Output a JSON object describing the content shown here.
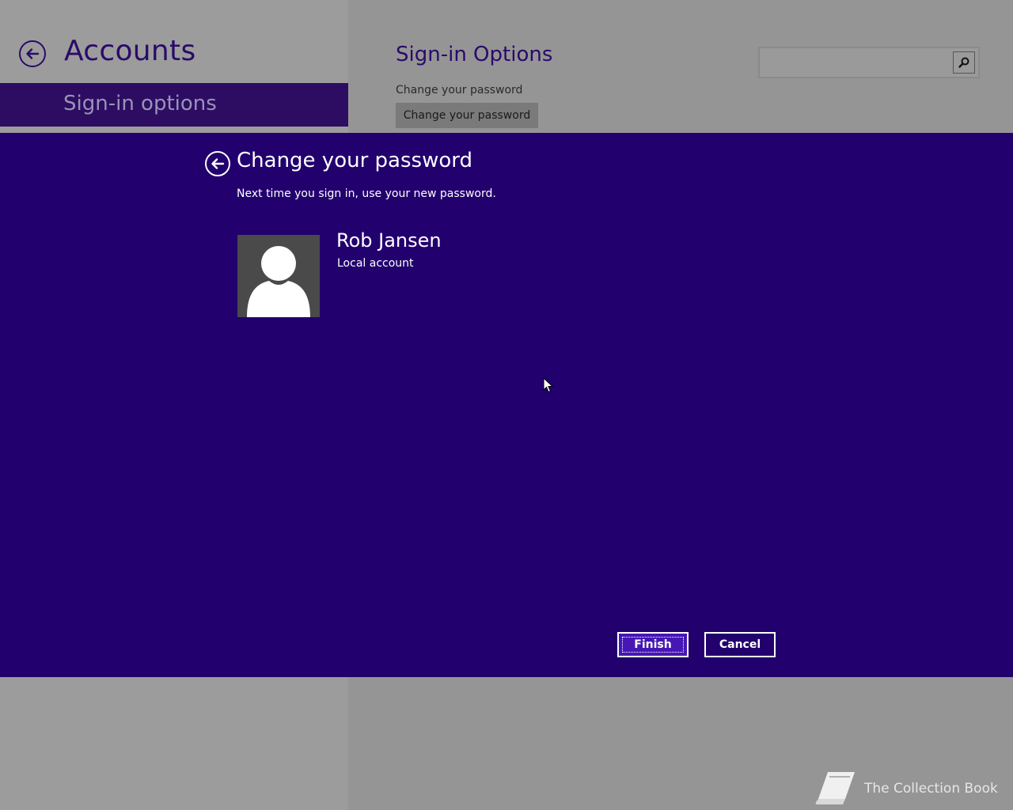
{
  "app": {
    "title": "Accounts",
    "nav_selected": "Sign-in options"
  },
  "content": {
    "section_title": "Sign-in Options",
    "caption": "Change your password",
    "button_label": "Change your password"
  },
  "search": {
    "value": "",
    "placeholder": ""
  },
  "dialog": {
    "title": "Change your password",
    "subtitle": "Next time you sign in, use your new password.",
    "user": {
      "name": "Rob Jansen",
      "account_type": "Local account"
    },
    "finish_label": "Finish",
    "cancel_label": "Cancel"
  },
  "watermark": {
    "text": "The Collection Book",
    "icon": "book-icon"
  },
  "colors": {
    "dialog_bg": "#22006e",
    "accent": "#2a0a6a",
    "finish_bg": "#4617b4",
    "page_bg": "#959595"
  }
}
